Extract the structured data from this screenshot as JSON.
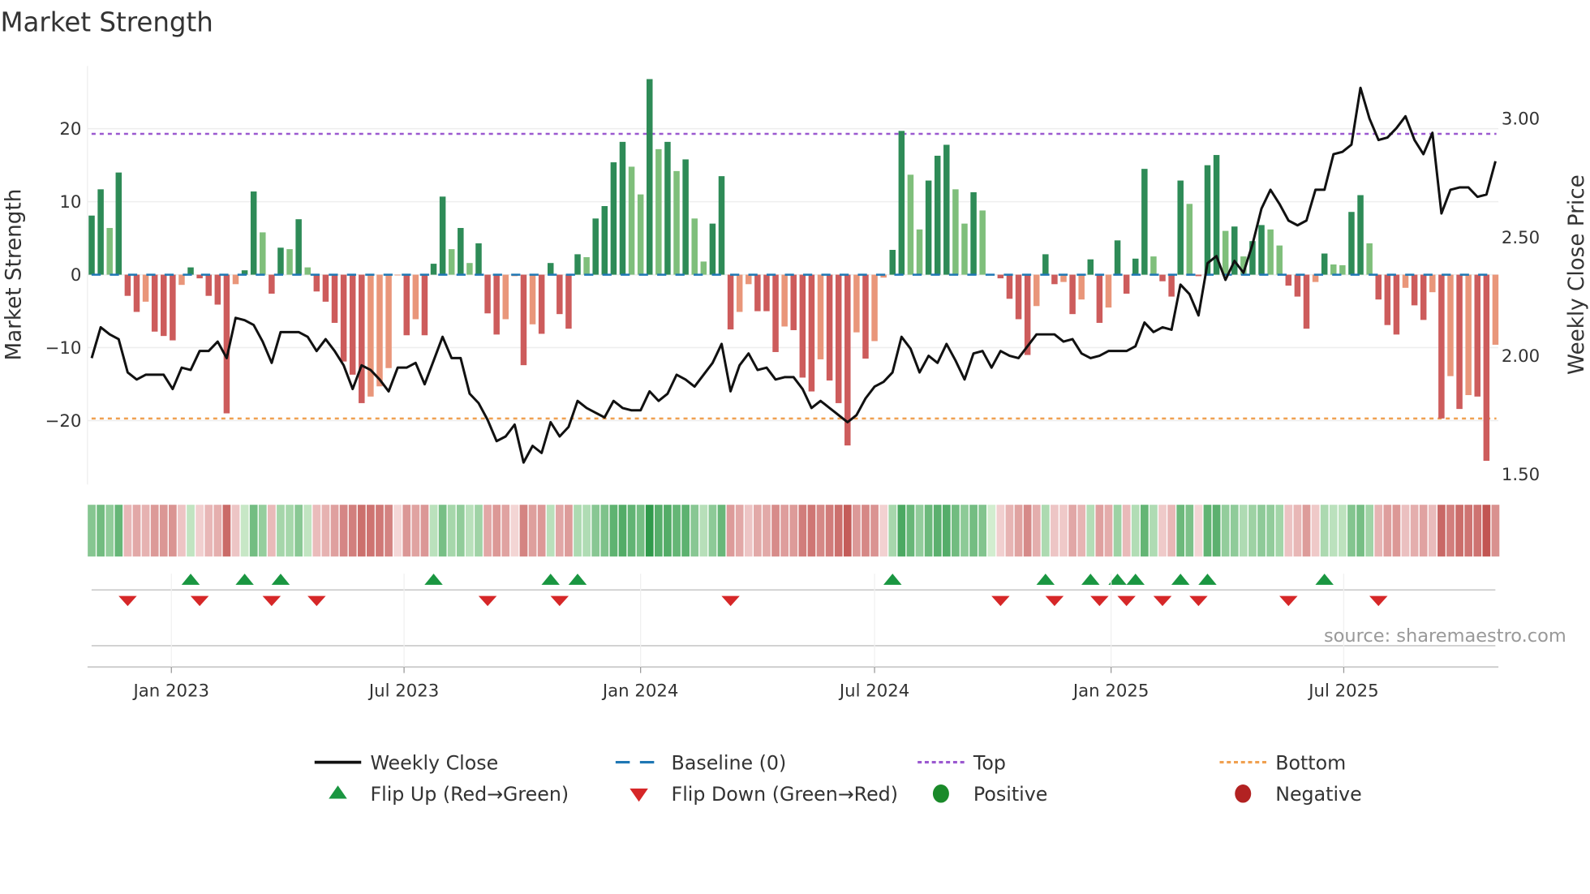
{
  "chart_data": {
    "type": "bar",
    "title": "Market Strength",
    "ylabel": "Market Strength",
    "y2label": "Weekly Close Price",
    "ylim": [
      -28,
      28
    ],
    "y2lim": [
      1.45,
      3.23
    ],
    "yticks": [
      20,
      10,
      0,
      -10,
      -20
    ],
    "ytick_labels": [
      "20",
      "10",
      "0",
      "−10",
      "−20"
    ],
    "y2ticks": [
      3.0,
      2.5,
      2.0,
      1.5
    ],
    "y2tick_labels": [
      "3.00",
      "2.50",
      "2.00",
      "1.50"
    ],
    "x_start": "2022-10-31",
    "x_step_days": 7,
    "xticks": [
      {
        "date": "2023-01-01",
        "label": "Jan 2023"
      },
      {
        "date": "2023-07-01",
        "label": "Jul 2023"
      },
      {
        "date": "2024-01-01",
        "label": "Jan 2024"
      },
      {
        "date": "2024-07-01",
        "label": "Jul 2024"
      },
      {
        "date": "2025-01-01",
        "label": "Jan 2025"
      },
      {
        "date": "2025-07-01",
        "label": "Jul 2025"
      }
    ],
    "top_level": 19.3,
    "bottom_level": -19.7,
    "baseline": 0,
    "strength": [
      8.1,
      11.7,
      6.4,
      14.0,
      -2.9,
      -5.1,
      -3.7,
      -7.8,
      -8.4,
      -9.0,
      -1.4,
      1.0,
      -0.5,
      -2.9,
      -4.1,
      -19.0,
      -1.3,
      0.6,
      11.4,
      5.8,
      -2.6,
      3.7,
      3.5,
      7.6,
      1.0,
      -2.3,
      -3.7,
      -6.6,
      -11.9,
      -13.7,
      -17.6,
      -16.7,
      -15.3,
      -12.8,
      -0.1,
      -8.3,
      -6.1,
      -8.3,
      1.5,
      10.7,
      3.5,
      6.4,
      1.6,
      4.3,
      -5.3,
      -8.2,
      -6.1,
      -0.2,
      -12.4,
      -6.8,
      -8.1,
      1.6,
      -5.4,
      -7.4,
      2.8,
      2.4,
      7.7,
      9.4,
      15.4,
      18.2,
      14.8,
      11.0,
      26.8,
      17.2,
      18.2,
      14.2,
      15.8,
      7.7,
      1.8,
      7.0,
      13.5,
      -7.5,
      -5.1,
      -1.3,
      -5.0,
      -5.0,
      -10.6,
      -7.1,
      -7.6,
      -14.1,
      -16.0,
      -11.6,
      -14.5,
      -17.6,
      -23.4,
      -7.9,
      -11.5,
      -9.1,
      -0.4,
      3.4,
      19.7,
      13.7,
      6.2,
      12.9,
      16.3,
      17.8,
      11.7,
      7.0,
      11.3,
      8.8,
      0.1,
      -0.5,
      -3.3,
      -6.1,
      -11.0,
      -4.3,
      2.8,
      -1.3,
      -1.0,
      -5.4,
      -3.4,
      2.1,
      -6.6,
      -4.5,
      4.7,
      -2.6,
      2.2,
      14.5,
      2.5,
      -0.9,
      -3.0,
      12.9,
      9.7,
      -0.2,
      15.0,
      16.4,
      6.0,
      6.6,
      2.5,
      4.6,
      6.8,
      6.2,
      4.0,
      -1.5,
      -3.0,
      -7.4,
      -1.0,
      2.9,
      1.4,
      1.3,
      8.6,
      10.9,
      4.3,
      -3.4,
      -6.9,
      -8.2,
      -1.8,
      -4.2,
      -6.2,
      -2.4,
      -19.7,
      -13.9,
      -18.4,
      -16.5,
      -16.7,
      -25.5,
      -9.6
    ],
    "close": [
      1.99,
      2.12,
      2.09,
      2.07,
      1.93,
      1.9,
      1.92,
      1.92,
      1.92,
      1.86,
      1.95,
      1.94,
      2.02,
      2.02,
      2.06,
      1.99,
      2.16,
      2.15,
      2.13,
      2.06,
      1.97,
      2.1,
      2.1,
      2.1,
      2.08,
      2.02,
      2.07,
      2.02,
      1.96,
      1.86,
      1.96,
      1.94,
      1.9,
      1.85,
      1.95,
      1.95,
      1.97,
      1.88,
      1.98,
      2.08,
      1.99,
      1.99,
      1.84,
      1.8,
      1.73,
      1.64,
      1.66,
      1.71,
      1.55,
      1.62,
      1.59,
      1.72,
      1.66,
      1.7,
      1.81,
      1.78,
      1.76,
      1.74,
      1.81,
      1.78,
      1.77,
      1.77,
      1.85,
      1.81,
      1.84,
      1.92,
      1.9,
      1.87,
      1.92,
      1.97,
      2.05,
      1.85,
      1.96,
      2.01,
      1.94,
      1.95,
      1.9,
      1.91,
      1.91,
      1.86,
      1.78,
      1.81,
      1.78,
      1.75,
      1.72,
      1.75,
      1.82,
      1.87,
      1.89,
      1.93,
      2.08,
      2.03,
      1.93,
      2.0,
      1.97,
      2.05,
      1.98,
      1.9,
      2.01,
      2.02,
      1.95,
      2.02,
      2.0,
      1.99,
      2.04,
      2.09,
      2.09,
      2.09,
      2.06,
      2.07,
      2.01,
      1.99,
      2.0,
      2.02,
      2.02,
      2.02,
      2.04,
      2.14,
      2.1,
      2.12,
      2.11,
      2.3,
      2.26,
      2.17,
      2.39,
      2.42,
      2.32,
      2.4,
      2.35,
      2.47,
      2.62,
      2.7,
      2.64,
      2.57,
      2.55,
      2.57,
      2.7,
      2.7,
      2.85,
      2.86,
      2.89,
      3.13,
      3.0,
      2.91,
      2.92,
      2.96,
      3.01,
      2.91,
      2.85,
      2.94,
      2.6,
      2.7,
      2.71,
      2.71,
      2.67,
      2.68,
      2.82
    ],
    "legend": {
      "placement": "bottom-center",
      "items": [
        {
          "label": "Weekly Close",
          "kind": "line"
        },
        {
          "label": "Baseline (0)",
          "kind": "dash"
        },
        {
          "label": "Top",
          "kind": "dot-purple"
        },
        {
          "label": "Bottom",
          "kind": "dot-orange"
        },
        {
          "label": "Flip Up (Red→Green)",
          "kind": "up"
        },
        {
          "label": "Flip Down (Green→Red)",
          "kind": "down"
        },
        {
          "label": "Positive",
          "kind": "circle-green"
        },
        {
          "label": "Negative",
          "kind": "circle-red"
        }
      ]
    },
    "source": "source: sharemaestro.com",
    "grid": true
  },
  "colors": {
    "pos_strong": "#2e8b57",
    "pos_weak": "#7fbf7b",
    "neg_strong": "#cd5c5c",
    "neg_weak": "#e9967a",
    "line": "#111111",
    "baseline": "#1f77b4",
    "top": "#9b59d0",
    "bottom": "#f0a050",
    "flip_up": "#1a9641",
    "flip_down": "#d62728",
    "positive": "#1a8a2a",
    "negative": "#b22222"
  }
}
